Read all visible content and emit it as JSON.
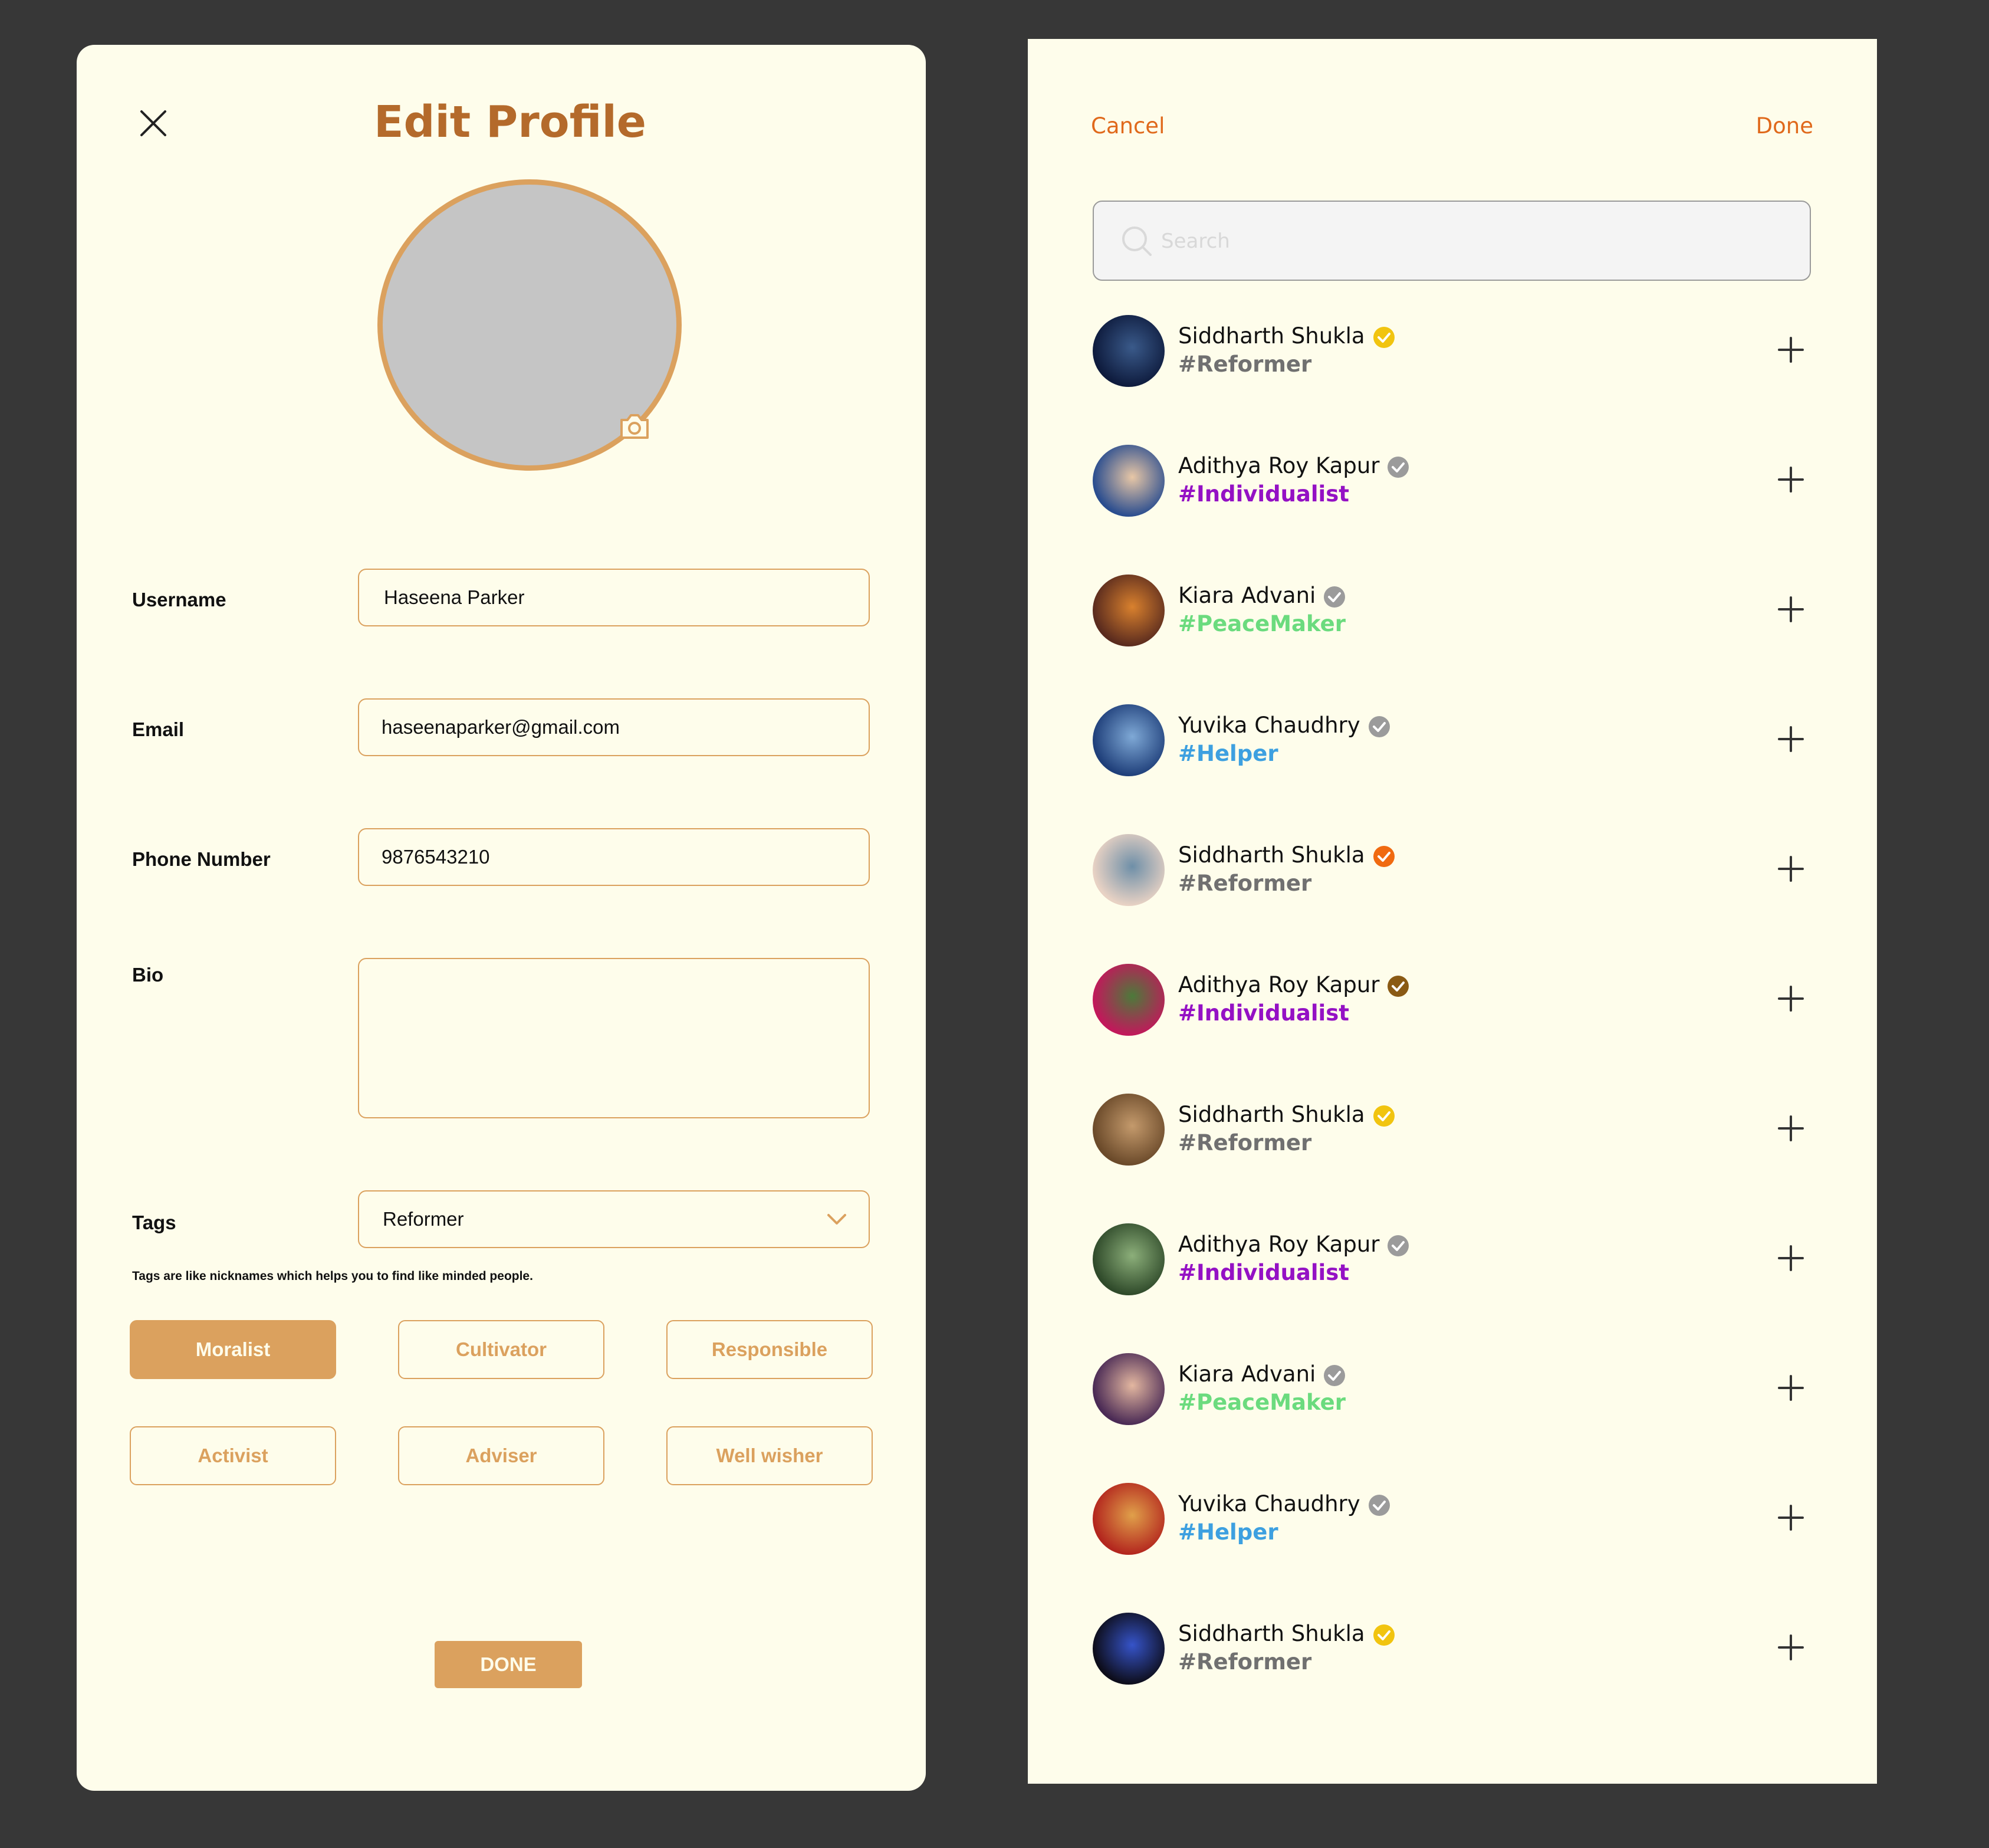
{
  "edit_profile": {
    "title": "Edit Profile",
    "fields": {
      "username": {
        "label": "Username",
        "value": "Haseena Parker"
      },
      "email": {
        "label": "Email",
        "value": "haseenaparker@gmail.com"
      },
      "phone": {
        "label": "Phone Number",
        "value": "9876543210"
      },
      "bio": {
        "label": "Bio",
        "value": ""
      },
      "tags": {
        "label": "Tags",
        "selected": "Reformer"
      }
    },
    "tags_helper": "Tags are like nicknames which helps you to find like minded people.",
    "tag_chips": [
      "Moralist",
      "Cultivator",
      "Responsible",
      "Activist",
      "Adviser",
      "Well wisher"
    ],
    "active_chip": "Moralist",
    "done_label": "DONE",
    "colors": {
      "accent": "#DBA15E",
      "title": "#B46A2B",
      "background": "#FEFDEB",
      "avatar_placeholder": "#C5C5C5"
    }
  },
  "add_people": {
    "cancel_label": "Cancel",
    "done_label": "Done",
    "search": {
      "placeholder": "Search"
    },
    "users": [
      {
        "name": "Siddharth Shukla",
        "tag": "#Reformer",
        "badge": "gold",
        "tag_color": "#707070",
        "avatar": [
          "#0E1B3D",
          "#3A5A8A"
        ]
      },
      {
        "name": "Adithya Roy Kapur",
        "tag": "#Individualist",
        "badge": "gray",
        "tag_color": "#9411C4",
        "avatar": [
          "#2A4D8F",
          "#E8C7A6"
        ]
      },
      {
        "name": "Kiara Advani",
        "tag": "#PeaceMaker",
        "badge": "gray",
        "tag_color": "#6BDB7E",
        "avatar": [
          "#5A2B1E",
          "#D9812E"
        ]
      },
      {
        "name": "Yuvika Chaudhry",
        "tag": "#Helper",
        "badge": "gray",
        "tag_color": "#3DA0E0",
        "avatar": [
          "#1F3F7A",
          "#7FA9D6"
        ]
      },
      {
        "name": "Siddharth Shukla",
        "tag": "#Reformer",
        "badge": "orange",
        "tag_color": "#707070",
        "avatar": [
          "#E8D2C4",
          "#6E8FA8"
        ]
      },
      {
        "name": "Adithya Roy Kapur",
        "tag": "#Individualist",
        "badge": "bronze",
        "tag_color": "#9411C4",
        "avatar": [
          "#C2185B",
          "#4C7A3A"
        ]
      },
      {
        "name": "Siddharth Shukla",
        "tag": "#Reformer",
        "badge": "gold",
        "tag_color": "#707070",
        "avatar": [
          "#6B4A2A",
          "#C49A6C"
        ]
      },
      {
        "name": "Adithya Roy Kapur",
        "tag": "#Individualist",
        "badge": "gray",
        "tag_color": "#9411C4",
        "avatar": [
          "#2F4A2A",
          "#8CAF7A"
        ]
      },
      {
        "name": "Kiara Advani",
        "tag": "#PeaceMaker",
        "badge": "gray",
        "tag_color": "#6BDB7E",
        "avatar": [
          "#4A2A55",
          "#E3B7A0"
        ]
      },
      {
        "name": "Yuvika Chaudhry",
        "tag": "#Helper",
        "badge": "gray",
        "tag_color": "#3DA0E0",
        "avatar": [
          "#B3261E",
          "#E0A04A"
        ]
      },
      {
        "name": "Siddharth Shukla",
        "tag": "#Reformer",
        "badge": "gold",
        "tag_color": "#707070",
        "avatar": [
          "#0D0D1A",
          "#3654C9"
        ]
      }
    ],
    "badge_colors": {
      "gold": "#F1C40F",
      "gray": "#9B9B9B",
      "orange": "#F06A10",
      "bronze": "#8A5A14"
    },
    "colors": {
      "link": "#E0691B",
      "background": "#FEFDEB"
    }
  },
  "page": {
    "background": "#373737"
  }
}
